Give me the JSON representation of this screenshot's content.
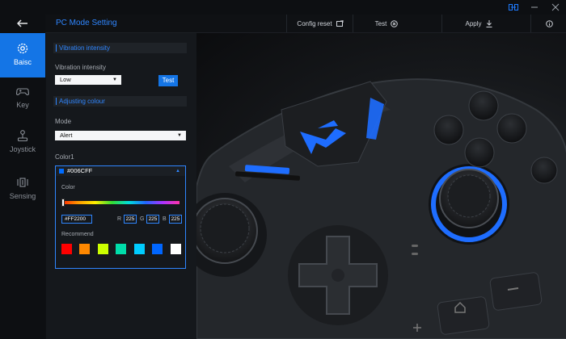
{
  "header": {
    "title": "PC Mode Setting",
    "config_reset": "Config reset",
    "test": "Test",
    "apply": "Apply"
  },
  "sidebar": {
    "items": [
      {
        "label": "Baisc",
        "icon": "gear-icon",
        "active": true
      },
      {
        "label": "Key",
        "icon": "gamepad-icon",
        "active": false
      },
      {
        "label": "Joystick",
        "icon": "joystick-icon",
        "active": false
      },
      {
        "label": "Sensing",
        "icon": "sensing-icon",
        "active": false
      }
    ]
  },
  "vibration": {
    "section_title": "Vibration intensity",
    "label": "Vibration intensity",
    "value": "Low",
    "test_button": "Test"
  },
  "colour": {
    "section_title": "Adjusting colour",
    "mode_label": "Mode",
    "mode_value": "Alert",
    "color1_label": "Color1",
    "color1_value": "#006CFF",
    "picker_label": "Color",
    "hex_value": "#FF2200",
    "r_label": "R",
    "r_value": "225",
    "g_label": "G",
    "g_value": "225",
    "b_label": "B",
    "b_value": "225",
    "recommend_label": "Recommend",
    "recommend_colors": [
      "#FF0000",
      "#FF8800",
      "#CCFF00",
      "#00DDAA",
      "#00CCFF",
      "#0066FF",
      "#FFFFFF"
    ]
  },
  "colors": {
    "accent": "#1475E6",
    "accent_text": "#2F86FF",
    "background": "#0F1114",
    "panel": "#15181C"
  }
}
